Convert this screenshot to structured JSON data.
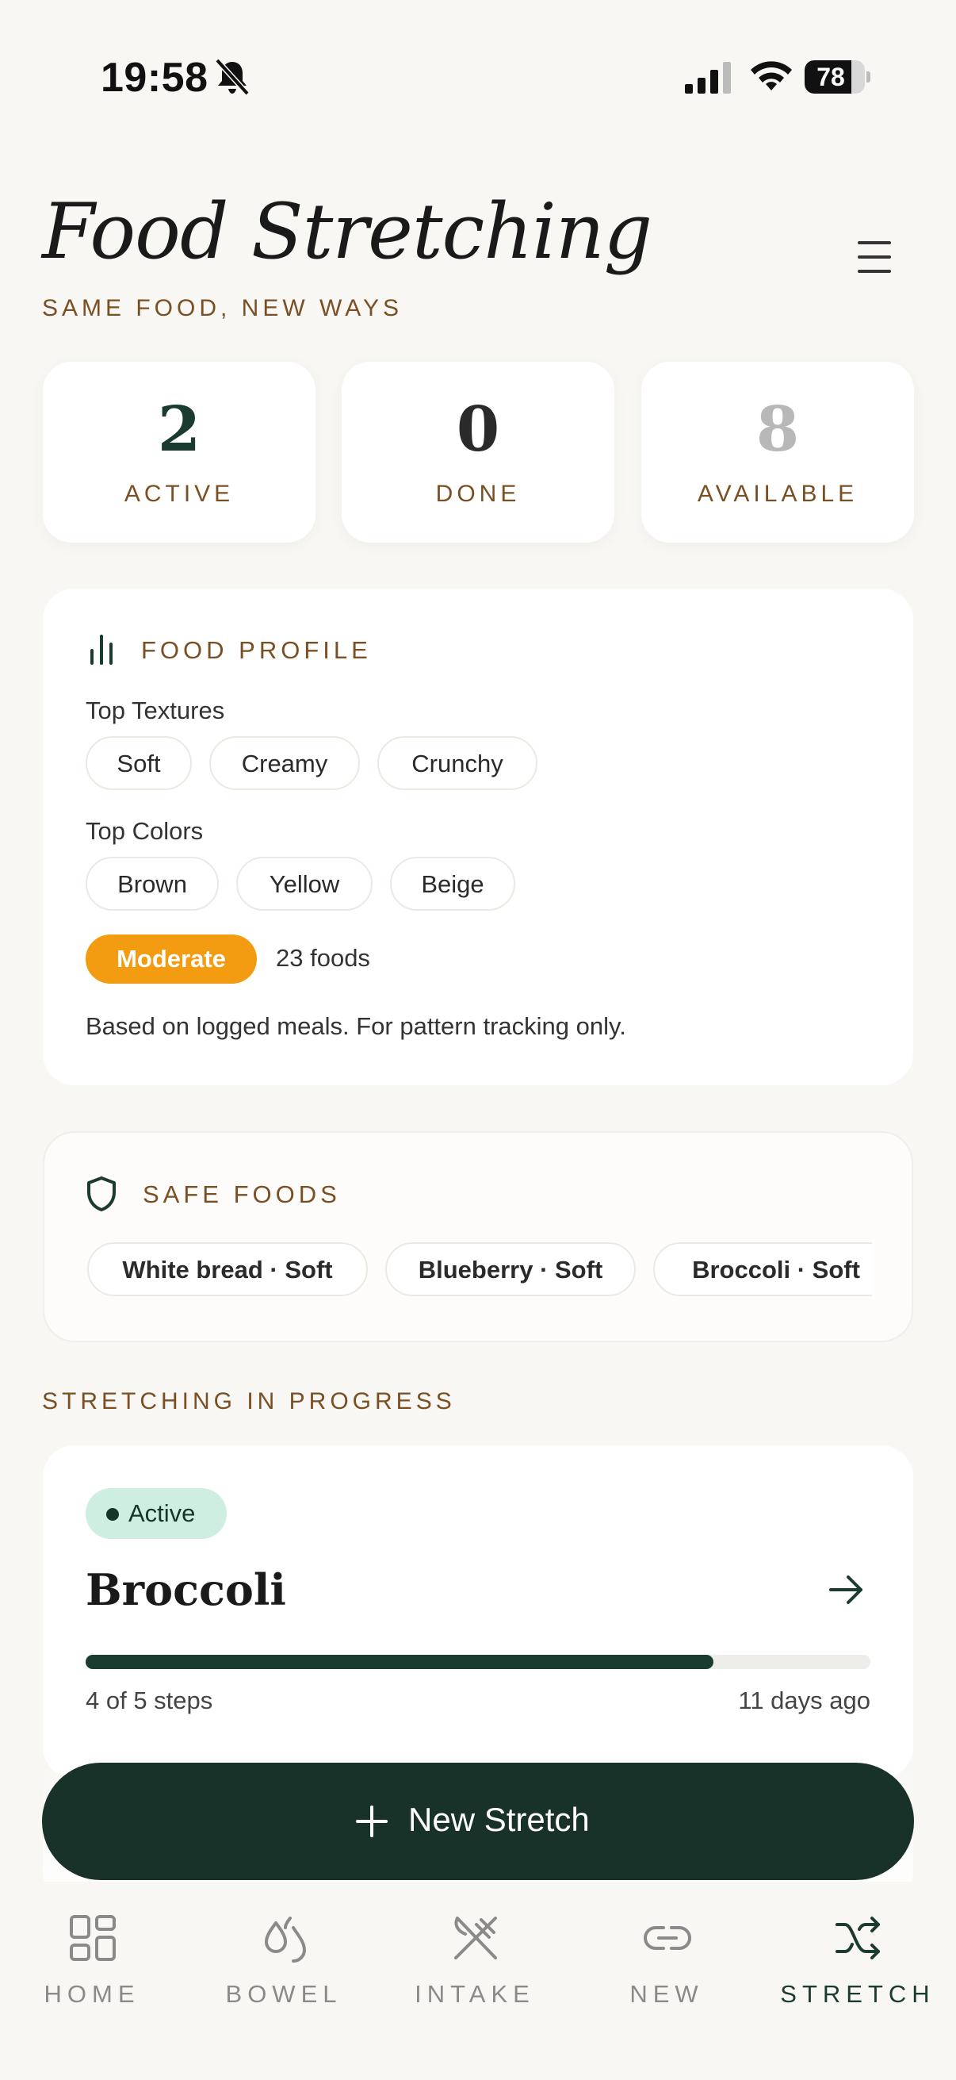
{
  "status_bar": {
    "time": "19:58",
    "battery": "78",
    "battery_level": 0.78
  },
  "header": {
    "title": "Food Stretching",
    "subtitle": "SAME FOOD, NEW WAYS"
  },
  "stats": [
    {
      "value": "2",
      "label": "ACTIVE",
      "color": "#1b3a30"
    },
    {
      "value": "0",
      "label": "DONE",
      "color": "#2a2a2a"
    },
    {
      "value": "8",
      "label": "AVAILABLE",
      "color": "#b8b8b8"
    }
  ],
  "food_profile": {
    "title": "FOOD PROFILE",
    "textures_label": "Top Textures",
    "textures": [
      "Soft",
      "Creamy",
      "Crunchy"
    ],
    "colors_label": "Top Colors",
    "colors": [
      "Brown",
      "Yellow",
      "Beige"
    ],
    "level": "Moderate",
    "level_color": "#f39c12",
    "food_count": "23 foods",
    "note": "Based on logged meals. For pattern tracking only."
  },
  "safe_foods": {
    "title": "SAFE FOODS",
    "items": [
      "White bread · Soft",
      "Blueberry · Soft",
      "Broccoli · Soft"
    ]
  },
  "in_progress": {
    "title": "STRETCHING IN PROGRESS",
    "card": {
      "status": "Active",
      "food": "Broccoli",
      "progress": 0.8,
      "steps": "4 of 5 steps",
      "ago": "11 days ago"
    }
  },
  "fab": {
    "label": "New Stretch"
  },
  "nav": [
    {
      "label": "HOME",
      "icon": "grid-icon",
      "active": false
    },
    {
      "label": "BOWEL",
      "icon": "drops-icon",
      "active": false
    },
    {
      "label": "INTAKE",
      "icon": "utensils-crossed-icon",
      "active": false
    },
    {
      "label": "NEW",
      "icon": "link-icon",
      "active": false
    },
    {
      "label": "STRETCH",
      "icon": "shuffle-icon",
      "active": true
    }
  ],
  "colors": {
    "accent": "#193229",
    "brand_brown": "#7a4f24",
    "background": "#f8f7f4"
  }
}
